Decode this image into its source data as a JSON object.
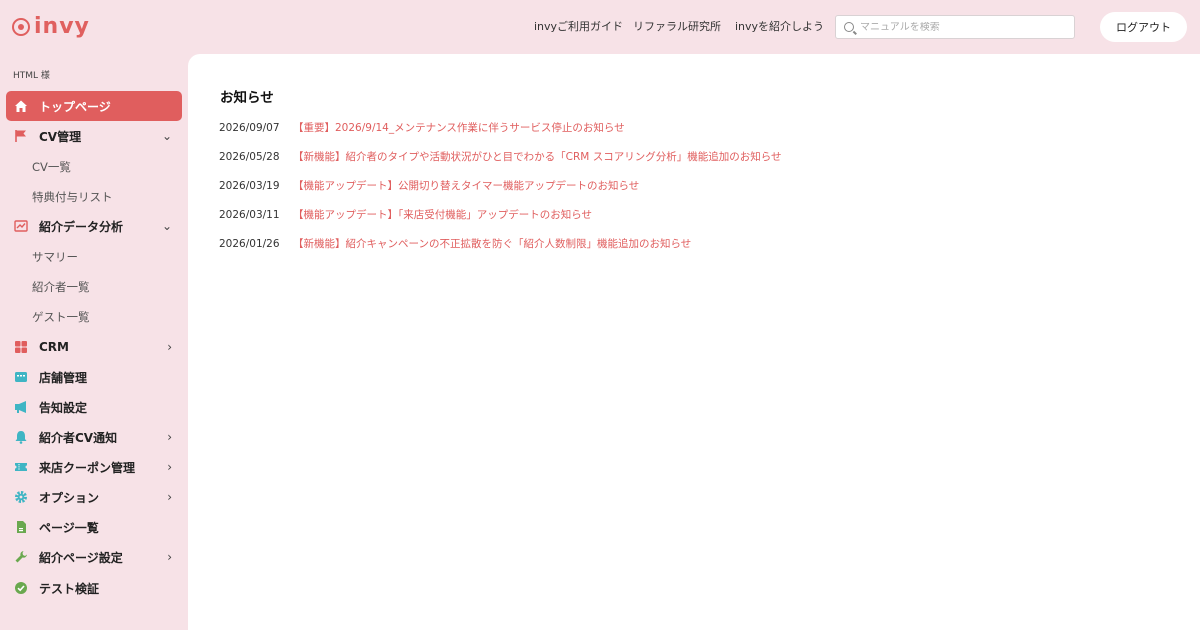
{
  "header": {
    "logo_text": "invy",
    "nav": [
      "invyご利用ガイド",
      "リファラル研究所",
      "invyを紹介しよう"
    ],
    "search_placeholder": "マニュアルを検索",
    "logout_label": "ログアウト"
  },
  "sidebar": {
    "user_label": "HTML 様",
    "items": [
      {
        "label": "トップページ",
        "icon": "home-icon",
        "active": true
      },
      {
        "label": "CV管理",
        "icon": "flag-icon",
        "chevron": "down"
      },
      {
        "label": "CV一覧",
        "sub": true
      },
      {
        "label": "特典付与リスト",
        "sub": true
      },
      {
        "label": "紹介データ分析",
        "icon": "chart-icon",
        "chevron": "down"
      },
      {
        "label": "サマリー",
        "sub": true
      },
      {
        "label": "紹介者一覧",
        "sub": true
      },
      {
        "label": "ゲスト一覧",
        "sub": true
      },
      {
        "label": "CRM",
        "icon": "grid-icon",
        "chevron": "right"
      },
      {
        "label": "店舗管理",
        "icon": "store-icon"
      },
      {
        "label": "告知設定",
        "icon": "megaphone-icon"
      },
      {
        "label": "紹介者CV通知",
        "icon": "bell-icon",
        "chevron": "right"
      },
      {
        "label": "来店クーポン管理",
        "icon": "ticket-icon",
        "chevron": "right"
      },
      {
        "label": "オプション",
        "icon": "gear-icon",
        "chevron": "right"
      },
      {
        "label": "ページ一覧",
        "icon": "page-icon"
      },
      {
        "label": "紹介ページ設定",
        "icon": "wrench-icon",
        "chevron": "right"
      },
      {
        "label": "テスト検証",
        "icon": "check-circle-icon"
      }
    ]
  },
  "main": {
    "title": "お知らせ",
    "news": [
      {
        "date": "2026/09/07",
        "text": "【重要】2026/9/14_メンテナンス作業に伴うサービス停止のお知らせ"
      },
      {
        "date": "2026/05/28",
        "text": "【新機能】紹介者のタイプや活動状況がひと目でわかる「CRM スコアリング分析」機能追加のお知らせ"
      },
      {
        "date": "2026/03/19",
        "text": "【機能アップデート】公開切り替えタイマー機能アップデートのお知らせ"
      },
      {
        "date": "2026/03/11",
        "text": "【機能アップデート】「来店受付機能」アップデートのお知らせ"
      },
      {
        "date": "2026/01/26",
        "text": "【新機能】紹介キャンペーンの不正拡散を防ぐ「紹介人数制限」機能追加のお知らせ"
      }
    ]
  },
  "colors": {
    "accent": "#e05e5e",
    "background": "#f7e2e7",
    "teal": "#3fb5c4",
    "green": "#6aa84f"
  }
}
